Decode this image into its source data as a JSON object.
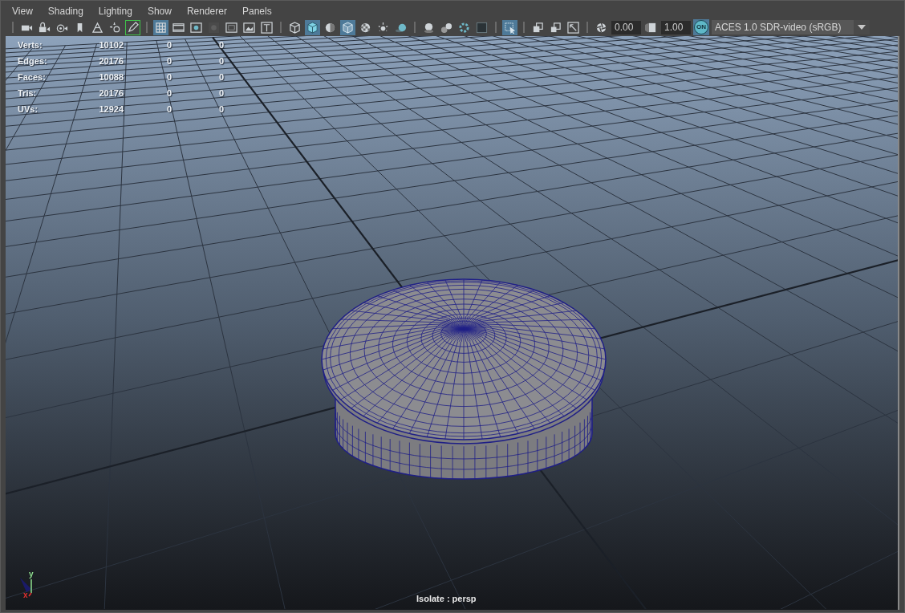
{
  "menu": [
    "View",
    "Shading",
    "Lighting",
    "Show",
    "Renderer",
    "Panels"
  ],
  "toolbar": [
    {
      "kind": "sep"
    },
    {
      "kind": "icon",
      "selected": false,
      "outlined": false
    },
    {
      "kind": "icon",
      "selected": false,
      "outlined": false
    },
    {
      "kind": "icon",
      "selected": false,
      "outlined": false
    },
    {
      "kind": "icon",
      "selected": false,
      "outlined": false
    },
    {
      "kind": "icon",
      "selected": false,
      "outlined": false
    },
    {
      "kind": "icon",
      "selected": false,
      "outlined": false
    },
    {
      "kind": "icon",
      "selected": false,
      "outlined": true
    },
    {
      "kind": "sep"
    },
    {
      "kind": "icon",
      "selected": true,
      "outlined": false
    },
    {
      "kind": "icon",
      "selected": false,
      "outlined": false
    },
    {
      "kind": "icon",
      "selected": false,
      "outlined": false
    },
    {
      "kind": "icon",
      "selected": false,
      "outlined": false
    },
    {
      "kind": "icon",
      "selected": false,
      "outlined": false
    },
    {
      "kind": "icon",
      "selected": false,
      "outlined": false
    },
    {
      "kind": "icon",
      "selected": false,
      "outlined": false
    },
    {
      "kind": "sep"
    },
    {
      "kind": "icon",
      "selected": false,
      "outlined": false
    },
    {
      "kind": "icon",
      "selected": true,
      "outlined": false
    },
    {
      "kind": "icon",
      "selected": false,
      "outlined": false
    },
    {
      "kind": "icon",
      "selected": true,
      "outlined": false
    },
    {
      "kind": "icon",
      "selected": false,
      "outlined": false
    },
    {
      "kind": "icon",
      "selected": false,
      "outlined": false
    },
    {
      "kind": "icon",
      "selected": false,
      "outlined": false
    },
    {
      "kind": "sep"
    },
    {
      "kind": "icon",
      "selected": false,
      "outlined": false
    },
    {
      "kind": "icon",
      "selected": false,
      "outlined": false
    },
    {
      "kind": "icon",
      "selected": false,
      "outlined": false
    },
    {
      "kind": "icon",
      "selected": false,
      "outlined": false
    },
    {
      "kind": "sep"
    },
    {
      "kind": "icon",
      "selected": true,
      "outlined": false
    },
    {
      "kind": "sep"
    },
    {
      "kind": "icon",
      "selected": false,
      "outlined": false
    },
    {
      "kind": "icon",
      "selected": false,
      "outlined": false
    },
    {
      "kind": "icon",
      "selected": false,
      "outlined": false
    },
    {
      "kind": "sep"
    },
    {
      "kind": "icon",
      "selected": false,
      "outlined": false
    },
    {
      "kind": "field",
      "value": "0.00"
    },
    {
      "kind": "icon",
      "selected": false,
      "outlined": false
    },
    {
      "kind": "field",
      "value": "1.00"
    },
    {
      "kind": "badge",
      "label": "ON"
    },
    {
      "kind": "dropdown",
      "value": "ACES 1.0 SDR-video (sRGB)"
    }
  ],
  "stats": [
    {
      "label": "Verts:",
      "value": "10102",
      "column_3": "0",
      "column_4": "0"
    },
    {
      "label": "Edges:",
      "value": "20176",
      "column_3": "0",
      "column_4": "0"
    },
    {
      "label": "Faces:",
      "value": "10088",
      "column_3": "0",
      "column_4": "0"
    },
    {
      "label": "Tris:",
      "value": "20176",
      "column_3": "0",
      "column_4": "0"
    },
    {
      "label": "UVs:",
      "value": "12924",
      "column_3": "0",
      "column_4": "0"
    }
  ],
  "axis_labels": [
    "y",
    "x"
  ],
  "viewport_label": "Isolate : persp"
}
